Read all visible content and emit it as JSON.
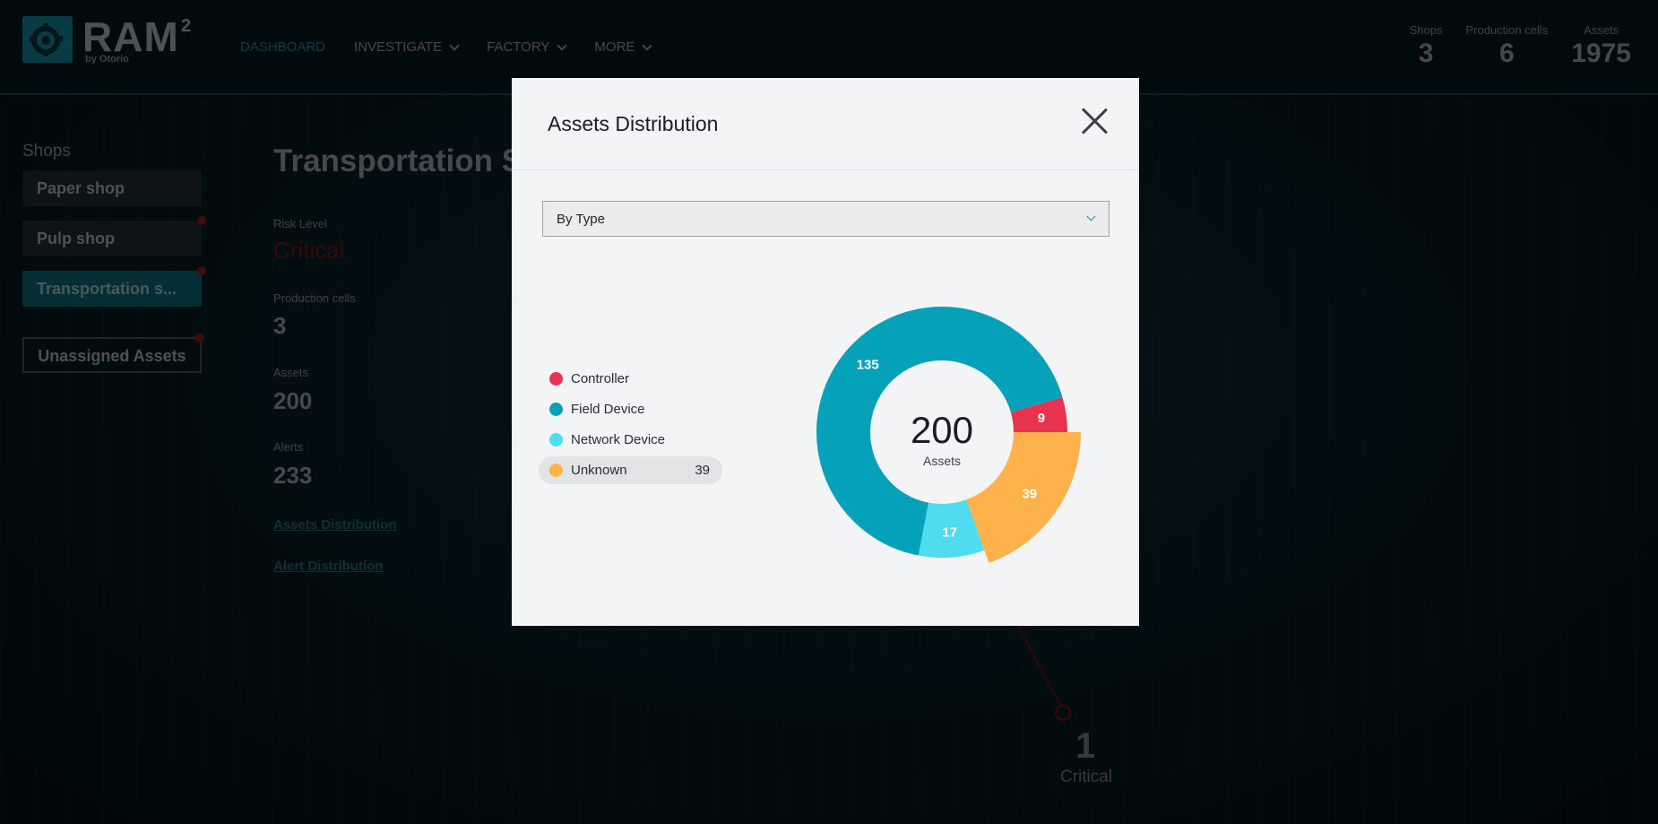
{
  "app": {
    "logo_text": "RAM",
    "logo_sup": "2",
    "logo_sub": "by Otorio"
  },
  "nav": [
    {
      "label": "DASHBOARD",
      "active": true,
      "dropdown": false
    },
    {
      "label": "INVESTIGATE",
      "active": false,
      "dropdown": true
    },
    {
      "label": "FACTORY",
      "active": false,
      "dropdown": true
    },
    {
      "label": "MORE",
      "active": false,
      "dropdown": true
    }
  ],
  "header_stats": [
    {
      "label": "Shops",
      "value": "3"
    },
    {
      "label": "Production cells",
      "value": "6"
    },
    {
      "label": "Assets",
      "value": "1975"
    }
  ],
  "sidebar": {
    "title": "Shops",
    "items": [
      {
        "label": "Paper shop"
      },
      {
        "label": "Pulp shop"
      },
      {
        "label": "Transportation s..."
      },
      {
        "label": "Unassigned Assets"
      }
    ]
  },
  "main": {
    "title": "Transportation Sh",
    "risk_label": "Risk Level",
    "risk_value": "Critical",
    "cells_label": "Production cells",
    "cells_value": "3",
    "assets_label": "Assets",
    "assets_value": "200",
    "alerts_label": "Alerts",
    "alerts_value": "233",
    "link_assets": "Assets Distribution",
    "link_alerts": "Alert Distribution",
    "critical_count": "1",
    "critical_label": "Critical"
  },
  "modal": {
    "title": "Assets Distribution",
    "select_value": "By Type",
    "legend": [
      {
        "label": "Controller",
        "color": "#e8334f",
        "count": ""
      },
      {
        "label": "Field Device",
        "color": "#05a1b8",
        "count": ""
      },
      {
        "label": "Network Device",
        "color": "#4fdcf0",
        "count": ""
      },
      {
        "label": "Unknown",
        "color": "#fdb24c",
        "count": "39"
      }
    ],
    "center_value": "200",
    "center_label": "Assets"
  },
  "chart_data": {
    "type": "pie",
    "categories": [
      "Controller",
      "Unknown",
      "Network Device",
      "Field Device"
    ],
    "values": [
      9,
      39,
      17,
      135
    ],
    "colors": [
      "#e8334f",
      "#fdb24c",
      "#4fdcf0",
      "#05a1b8"
    ],
    "highlighted": "Unknown",
    "total": 200
  }
}
